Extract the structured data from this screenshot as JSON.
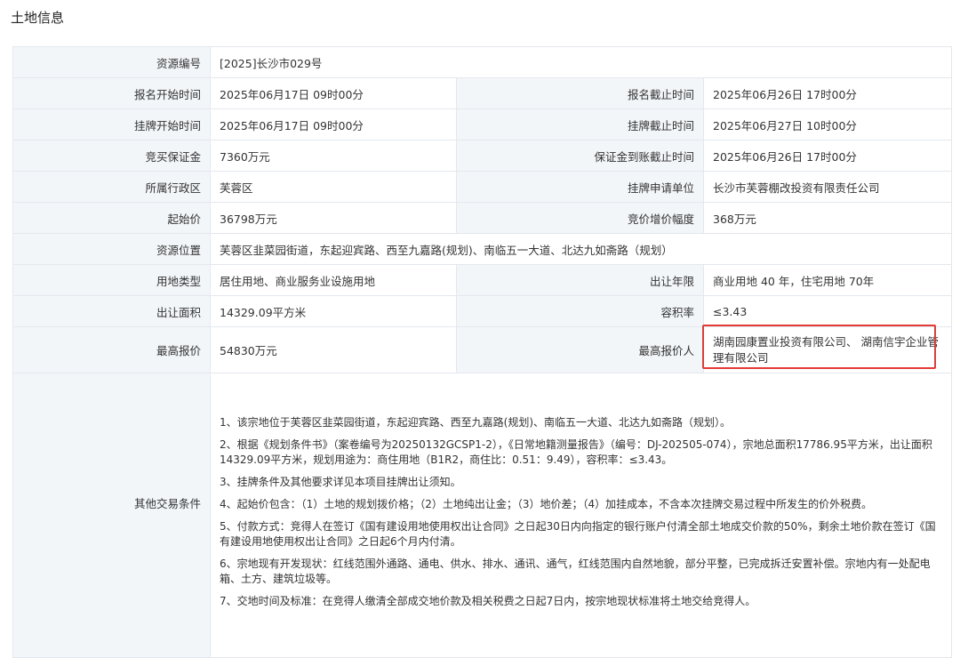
{
  "page": {
    "title": "土地信息"
  },
  "rows": {
    "resource_no": {
      "label": "资源编号",
      "value": "[2025]长沙市029号"
    },
    "reg_start": {
      "label": "报名开始时间",
      "value": "2025年06月17日 09时00分"
    },
    "reg_end": {
      "label": "报名截止时间",
      "value": "2025年06月26日 17时00分"
    },
    "list_start": {
      "label": "挂牌开始时间",
      "value": "2025年06月17日 09时00分"
    },
    "list_end": {
      "label": "挂牌截止时间",
      "value": "2025年06月27日 10时00分"
    },
    "deposit": {
      "label": "竞买保证金",
      "value": "7360万元"
    },
    "deposit_deadline": {
      "label": "保证金到账截止时间",
      "value": "2025年06月26日 17时00分"
    },
    "district": {
      "label": "所属行政区",
      "value": "芙蓉区"
    },
    "applicant": {
      "label": "挂牌申请单位",
      "value": "长沙市芙蓉棚改投资有限责任公司"
    },
    "start_price": {
      "label": "起始价",
      "value": "36798万元"
    },
    "increment": {
      "label": "竞价增价幅度",
      "value": "368万元"
    },
    "location": {
      "label": "资源位置",
      "value": "芙蓉区韭菜园街道，东起迎宾路、西至九嘉路(规划)、南临五一大道、北达九如斋路（规划）"
    },
    "land_use": {
      "label": "用地类型",
      "value": "居住用地、商业服务业设施用地"
    },
    "term": {
      "label": "出让年限",
      "value": "商业用地 40 年，住宅用地 70年"
    },
    "area": {
      "label": "出让面积",
      "value": "14329.09平方米"
    },
    "far": {
      "label": "容积率",
      "value": "≤3.43"
    },
    "top_price": {
      "label": "最高报价",
      "value": "54830万元"
    },
    "top_bidder": {
      "label": "最高报价人",
      "value": "湖南园康置业投资有限公司、 湖南信宇企业管理有限公司"
    }
  },
  "conditions": {
    "label": "其他交易条件",
    "items": [
      "1、该宗地位于芙蓉区韭菜园街道，东起迎宾路、西至九嘉路(规划)、南临五一大道、北达九如斋路（规划）。",
      "2、根据《规划条件书》（案卷编号为20250132GCSP1-2），《日常地籍测量报告》（编号：DJ-202505-074），宗地总面积17786.95平方米，出让面积14329.09平方米，规划用途为：商住用地（B1R2，商住比：0.51：9.49），容积率：≤3.43。",
      "3、挂牌条件及其他要求详见本项目挂牌出让须知。",
      "4、起始价包含：（1）土地的规划拨价格；（2）土地纯出让金；（3）地价差；（4）加挂成本，不含本次挂牌交易过程中所发生的价外税费。",
      "5、付款方式：竞得人在签订《国有建设用地使用权出让合同》之日起30日内向指定的银行账户付清全部土地成交价款的50%，剩余土地价款在签订《国有建设用地使用权出让合同》之日起6个月内付清。",
      "6、宗地现有开发现状：红线范围外通路、通电、供水、排水、通讯、通气，红线范围内自然地貌，部分平整，已完成拆迁安置补偿。宗地内有一处配电箱、土方、建筑垃圾等。",
      "7、交地时间及标准：在竞得人缴清全部成交地价款及相关税费之日起7日内，按宗地现状标准将土地交给竞得人。"
    ]
  },
  "highlight": {
    "color": "#e53935",
    "target": "top_bidder"
  }
}
